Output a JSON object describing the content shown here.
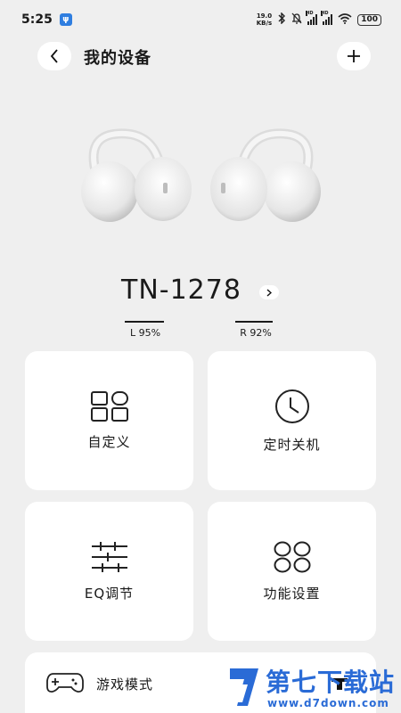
{
  "status_bar": {
    "time": "5:25",
    "usb_icon": "usb-icon",
    "net_speed_value": "19.0",
    "net_speed_unit": "KB/s",
    "signal_hd_1": "HD",
    "signal_hd_2": "HD",
    "battery": "100"
  },
  "header": {
    "title": "我的设备",
    "back_icon": "chevron-left-icon",
    "add_icon": "plus-icon",
    "add_label": "+"
  },
  "device": {
    "name": "TN-1278",
    "left_battery_label": "L 95%",
    "right_battery_label": "R 92%",
    "left_battery_level": 0.95,
    "right_battery_level": 0.92
  },
  "cards": [
    {
      "label": "自定义",
      "icon": "grid-icon"
    },
    {
      "label": "定时关机",
      "icon": "clock-icon"
    },
    {
      "label": "EQ调节",
      "icon": "sliders-icon"
    },
    {
      "label": "功能设置",
      "icon": "four-circles-icon"
    }
  ],
  "game_mode": {
    "label": "游戏模式",
    "icon": "gamepad-icon"
  },
  "watermark": {
    "title": "第七下载站",
    "url": "www.d7down.com"
  },
  "colors": {
    "background": "#efefef",
    "card": "#ffffff",
    "watermark": "#2a6bd6"
  }
}
